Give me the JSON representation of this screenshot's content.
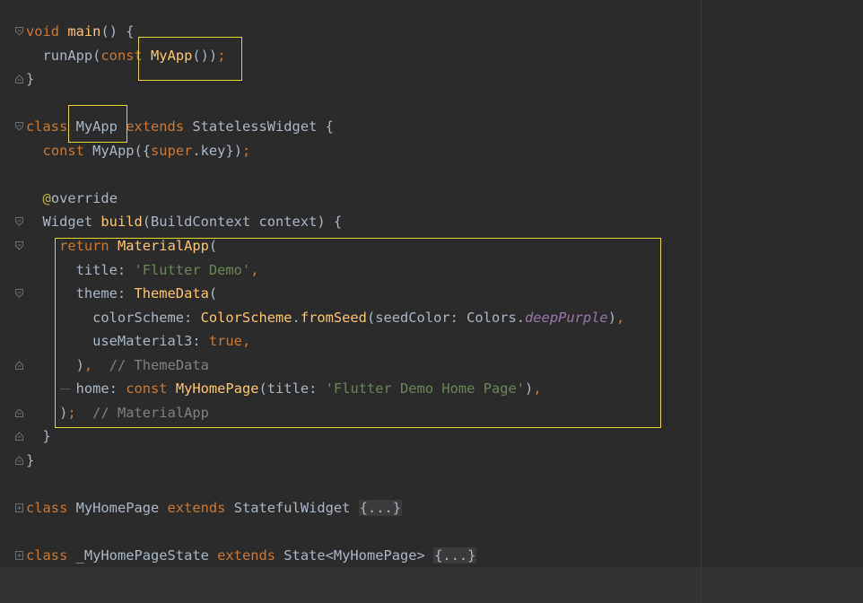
{
  "lines": [
    {
      "tokens": [
        [
          "kw",
          "void"
        ],
        [
          "plain",
          " "
        ],
        [
          "fn",
          "main"
        ],
        [
          "plain",
          "() {"
        ]
      ]
    },
    {
      "tokens": [
        [
          "plain",
          "  runApp("
        ],
        [
          "kw",
          "const"
        ],
        [
          "plain",
          " "
        ],
        [
          "fn",
          "MyApp"
        ],
        [
          "plain",
          "())"
        ],
        [
          "punc",
          ";"
        ]
      ]
    },
    {
      "tokens": [
        [
          "plain",
          "}"
        ]
      ]
    },
    {
      "tokens": []
    },
    {
      "tokens": [
        [
          "kw",
          "class"
        ],
        [
          "plain",
          " MyApp "
        ],
        [
          "kw",
          "extends"
        ],
        [
          "plain",
          " StatelessWidget {"
        ]
      ]
    },
    {
      "tokens": [
        [
          "plain",
          "  "
        ],
        [
          "kw",
          "const"
        ],
        [
          "plain",
          " MyApp({"
        ],
        [
          "kw",
          "super"
        ],
        [
          "plain",
          ".key})"
        ],
        [
          "punc",
          ";"
        ]
      ]
    },
    {
      "tokens": []
    },
    {
      "tokens": [
        [
          "plain",
          "  "
        ],
        [
          "ann",
          "@"
        ],
        [
          "plain",
          "override"
        ]
      ]
    },
    {
      "tokens": [
        [
          "plain",
          "  Widget "
        ],
        [
          "fn",
          "build"
        ],
        [
          "plain",
          "(BuildContext context) {"
        ]
      ]
    },
    {
      "tokens": [
        [
          "plain",
          "    "
        ],
        [
          "kw",
          "return"
        ],
        [
          "plain",
          " "
        ],
        [
          "fn",
          "MaterialApp"
        ],
        [
          "plain",
          "("
        ]
      ]
    },
    {
      "tokens": [
        [
          "plain",
          "      title: "
        ],
        [
          "str",
          "'Flutter Demo'"
        ],
        [
          "punc",
          ","
        ]
      ]
    },
    {
      "tokens": [
        [
          "plain",
          "      theme: "
        ],
        [
          "fn",
          "ThemeData"
        ],
        [
          "plain",
          "("
        ]
      ]
    },
    {
      "tokens": [
        [
          "plain",
          "        colorScheme: "
        ],
        [
          "fn",
          "ColorScheme"
        ],
        [
          "plain",
          "."
        ],
        [
          "fn",
          "fromSeed"
        ],
        [
          "plain",
          "(seedColor: Colors."
        ],
        [
          "const-field",
          "deepPurple"
        ],
        [
          "plain",
          ")"
        ],
        [
          "punc",
          ","
        ]
      ]
    },
    {
      "tokens": [
        [
          "plain",
          "        useMaterial3: "
        ],
        [
          "kw",
          "true"
        ],
        [
          "punc",
          ","
        ]
      ]
    },
    {
      "tokens": [
        [
          "plain",
          "      )"
        ],
        [
          "punc",
          ","
        ],
        [
          "plain",
          "  "
        ],
        [
          "cm",
          "// ThemeData"
        ]
      ]
    },
    {
      "tokens": [
        [
          "plain",
          "      home: "
        ],
        [
          "kw",
          "const"
        ],
        [
          "plain",
          " "
        ],
        [
          "fn",
          "MyHomePage"
        ],
        [
          "plain",
          "(title: "
        ],
        [
          "str",
          "'Flutter Demo Home Page'"
        ],
        [
          "plain",
          ")"
        ],
        [
          "punc",
          ","
        ]
      ]
    },
    {
      "tokens": [
        [
          "plain",
          "    )"
        ],
        [
          "punc",
          ";"
        ],
        [
          "plain",
          "  "
        ],
        [
          "cm",
          "// MaterialApp"
        ]
      ]
    },
    {
      "tokens": [
        [
          "plain",
          "  }"
        ]
      ]
    },
    {
      "tokens": [
        [
          "plain",
          "}"
        ]
      ]
    },
    {
      "tokens": []
    },
    {
      "tokens": [
        [
          "kw",
          "class"
        ],
        [
          "plain",
          " MyHomePage "
        ],
        [
          "kw",
          "extends"
        ],
        [
          "plain",
          " StatefulWidget "
        ],
        [
          "folded",
          "{...}"
        ]
      ]
    },
    {
      "tokens": []
    },
    {
      "tokens": [
        [
          "kw",
          "class"
        ],
        [
          "plain",
          " _MyHomePageState "
        ],
        [
          "kw",
          "extends"
        ],
        [
          "plain",
          " State<MyHomePage> "
        ],
        [
          "folded",
          "{...}"
        ]
      ]
    }
  ],
  "colors": {
    "background": "#2b2b2b",
    "keyword": "#cc7832",
    "function": "#ffc66d",
    "string": "#6a8759",
    "comment": "#808080",
    "annotation": "#bbb529",
    "constant_field": "#9876aa",
    "highlight_box": "#e6d82a"
  }
}
